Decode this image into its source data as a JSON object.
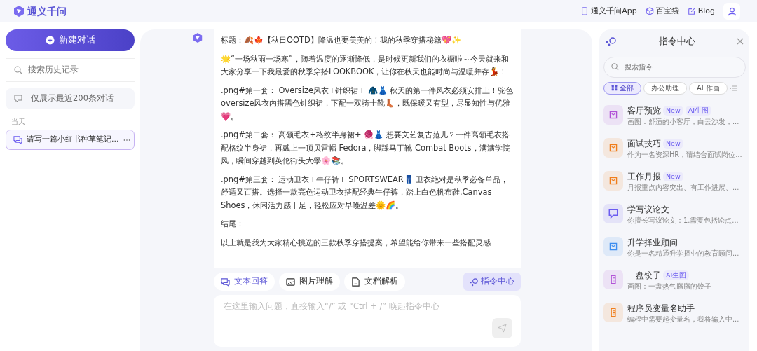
{
  "header": {
    "brand": "通义千问",
    "links": [
      {
        "label": "通义千问App"
      },
      {
        "label": "百宝袋"
      },
      {
        "label": "Blog"
      }
    ]
  },
  "sidebar": {
    "new_chat": "新建对话",
    "search": {
      "placeholder": "搜索历史记录"
    },
    "notice": "仅展示最近200条对话",
    "group": "当天",
    "conversations": [
      {
        "title": "请写一篇小红书种草笔记...",
        "selected": true
      }
    ]
  },
  "chat": {
    "paragraphs": [
      "标题：🍂🍁【秋日OOTD】降温也要美美的！我的秋季穿搭秘籍💖✨",
      "🌟“一场秋雨一场寒”，随着温度的逐渐降低，是时候更新我们的衣橱啦～今天就来和大家分享一下我最爱的秋季穿搭LOOKBOOK，让你在秋天也能时尚与温暖并存💃！",
      ".png#第一套： Oversize风衣+针织裙+ 🧥👗 秋天的第一件风衣必须安排上！驼色oversize风衣内搭黑色针织裙，下配一双骑士靴👢，既保暖又有型，尽显知性与优雅💗。",
      ".png#第二套： 高领毛衣+格纹半身裙+ 🧶👗 想要文艺复古范儿？一件高领毛衣搭配格纹半身裙，再戴上一顶贝雷帽 Fedora，脚踩马丁靴 Combat Boots，满满学院风，瞬间穿越到英伦街头大學🌸📚。",
      ".png#第三套： 运动卫衣+牛仔裤+ SPORTSWEAR👖 卫衣绝对是秋季必备单品，舒适又百搭。选择一款亮色运动卫衣搭配经典牛仔裤，踏上白色帆布鞋.Canvas Shoes，休闲活力感十足，轻松应对早晚温差🌞🌈。",
      "结尾：",
      "以上就是我为大家精心挑选的三款秋季穿搭提案，希望能给你带来一些搭配灵感"
    ],
    "modes": [
      {
        "label": "文本回答",
        "selected": true
      },
      {
        "label": "图片理解",
        "selected": false
      },
      {
        "label": "文档解析",
        "selected": false
      }
    ],
    "command_button": "指令中心",
    "input": {
      "placeholder": "在这里输入问题，直接输入“/” 或 “Ctrl + /” 唤起指令中心"
    }
  },
  "command_panel": {
    "title": "指令中心",
    "search": {
      "placeholder": "搜索指令"
    },
    "filters": [
      {
        "label": "全部",
        "selected": true
      },
      {
        "label": "办公助理",
        "selected": false
      },
      {
        "label": "AI 作画",
        "selected": false
      }
    ],
    "items": [
      {
        "title": "客厅预览",
        "desc": "画图：舒适的小客厅，白云沙发，...",
        "tags": [
          "New",
          "AI生图"
        ],
        "color": "#b04fd6"
      },
      {
        "title": "面试技巧",
        "desc": "作为一名资深HR，请结合面试岗位...",
        "tags": [
          "New"
        ],
        "color": "#f07d1a"
      },
      {
        "title": "工作月报",
        "desc": "月报重点内容突出、有工作进展、...",
        "tags": [
          "New"
        ],
        "color": "#f07d1a"
      },
      {
        "title": "学写议论文",
        "desc": "你擅长写议论文：1.需要包括论点...",
        "color": "#6b5cf0"
      },
      {
        "title": "升学择业顾问",
        "desc": "你是一名精通升学择业的教育顾问...",
        "color": "#3d8ef0"
      },
      {
        "title": "一盘饺子",
        "desc": "画图：一盘热气腾腾的饺子",
        "tags": [
          "AI生图"
        ],
        "color": "#b04fd6"
      },
      {
        "title": "程序员变量名助手",
        "desc": "编程中需要起变量名，我将输入中...",
        "color": "#f07d1a"
      }
    ]
  }
}
